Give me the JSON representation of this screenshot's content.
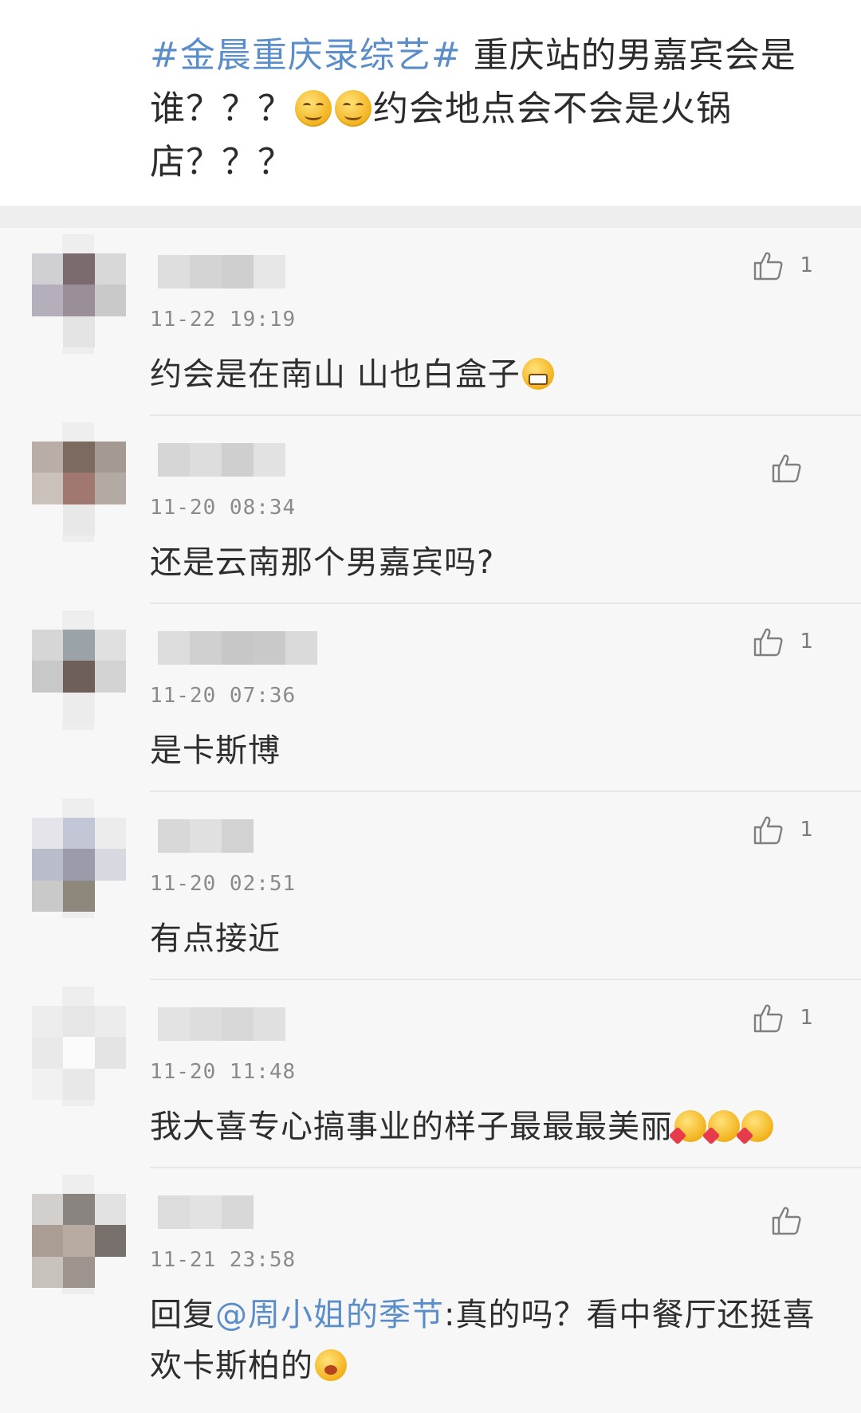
{
  "post": {
    "hashtag": "#金晨重庆录综艺#",
    "text_part1": " 重庆站的男嘉宾会是谁？？？",
    "text_part2": "约会地点会不会是火锅店？？？"
  },
  "comments": [
    {
      "timestamp": "11-22 19:19",
      "text": "约会是在南山 山也白盒子",
      "like_count": "1",
      "emoji": "grin"
    },
    {
      "timestamp": "11-20 08:34",
      "text": "还是云南那个男嘉宾吗?",
      "like_count": ""
    },
    {
      "timestamp": "11-20 07:36",
      "text": "是卡斯博",
      "like_count": "1"
    },
    {
      "timestamp": "11-20 02:51",
      "text": "有点接近",
      "like_count": "1"
    },
    {
      "timestamp": "11-20 11:48",
      "text": "我大喜专心搞事业的样子最最最美丽",
      "like_count": "1"
    },
    {
      "timestamp": "11-21 23:58",
      "reply_prefix": "回复",
      "mention": "@周小姐的季节",
      "text": ":真的吗？看中餐厅还挺喜欢卡斯柏的",
      "like_count": ""
    }
  ],
  "icons": {
    "like": "thumbs-up-icon"
  },
  "colors": {
    "link": "#5b8dc9",
    "background_list": "#f7f7f7",
    "separator": "#eeeeee",
    "timestamp": "#8a8a8a"
  }
}
